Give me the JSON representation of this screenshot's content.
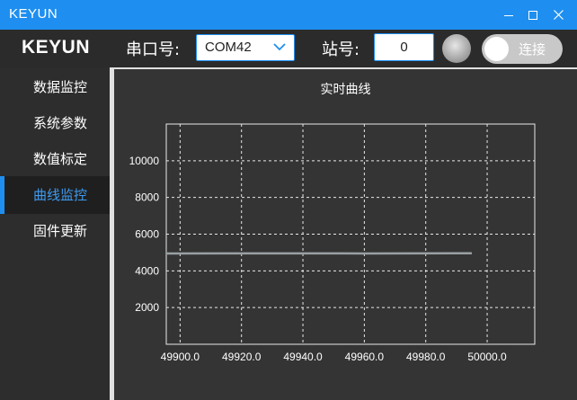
{
  "window": {
    "title": "KEYUN",
    "controls": {
      "minimize": "minimize-icon",
      "maximize": "maximize-icon",
      "close": "close-icon"
    }
  },
  "toolbar": {
    "brand": "KEYUN",
    "port_label": "串口号:",
    "port_value": "COM42",
    "station_label": "站号:",
    "station_value": "0",
    "connect_label": "连接"
  },
  "sidebar": {
    "items": [
      {
        "label": "数据监控",
        "active": false
      },
      {
        "label": "系统参数",
        "active": false
      },
      {
        "label": "数值标定",
        "active": false
      },
      {
        "label": "曲线监控",
        "active": true
      },
      {
        "label": "固件更新",
        "active": false
      }
    ]
  },
  "colors": {
    "titlebar": "#1e8ff0",
    "accent": "#3d9bf0",
    "series": "#9aa0a4"
  },
  "chart_data": {
    "type": "line",
    "title": "实时曲线",
    "xlabel": "",
    "ylabel": "",
    "xlim": [
      49895.5,
      50015.5
    ],
    "ylim": [
      0,
      12000
    ],
    "x_ticks": [
      49900.0,
      49920.0,
      49940.0,
      49960.0,
      49980.0,
      50000.0
    ],
    "x_tick_labels": [
      "49900.0",
      "49920.0",
      "49940.0",
      "49960.0",
      "49980.0",
      "50000.0"
    ],
    "y_ticks": [
      2000,
      4000,
      6000,
      8000,
      10000
    ],
    "y_tick_labels": [
      "2000",
      "4000",
      "6000",
      "8000",
      "10000"
    ],
    "grid": true,
    "series": [
      {
        "x": [
          49895.5,
          49930,
          49960,
          49995
        ],
        "y": [
          4950,
          4955,
          4950,
          4960
        ]
      }
    ]
  }
}
